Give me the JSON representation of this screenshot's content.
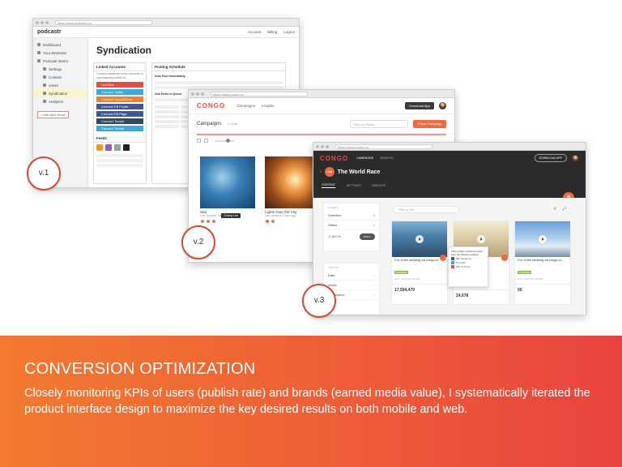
{
  "v1": {
    "url": "https://www.podcastr.co",
    "logo": "podcastr",
    "top_links": [
      "Account",
      "Billing",
      "Logout"
    ],
    "sidebar": [
      "Dashboard",
      "Your Moments",
      "Podcastr Demo",
      "Settings",
      "Content",
      "Users",
      "Syndication",
      "Analytics"
    ],
    "add_button": "+ Add New Show",
    "title": "Syndication",
    "linked_accounts_title": "Linked Accounts",
    "linked_accounts_text": "Connect additional social accounts to automatically publish to.",
    "accounts": [
      {
        "label": "YouTube",
        "color": "#e74c3c"
      },
      {
        "label": "Connect Twitter",
        "color": "#39a9e0"
      },
      {
        "label": "Connect SoundCloud",
        "color": "#f57e20"
      },
      {
        "label": "Connect FB Profile",
        "color": "#3b5998"
      },
      {
        "label": "Connect FB Page",
        "color": "#3b5998"
      },
      {
        "label": "Connect Tumblr",
        "color": "#34495e"
      },
      {
        "label": "Connect Tumblr",
        "color": "#39a9e0"
      }
    ],
    "feeds_title": "Feeds",
    "posting_title": "Posting Schedule",
    "auto_post": "Auto Post Immediately",
    "add_posts": "Add Posts to Queue"
  },
  "v2": {
    "url": "https://www.congo.co",
    "logo": "CONGO",
    "links": [
      "Campaigns",
      "Insights"
    ],
    "download_button": "Download App",
    "campaigns_label": "Campaigns",
    "total": "4 Total",
    "search_placeholder": "Filter by Name",
    "new_campaign": "+ New Campaign",
    "cards": [
      {
        "title": "Sea",
        "sub": "Last updated 2 days ago"
      },
      {
        "title": "Lights Over the City",
        "sub": "Last updated 4 days ago"
      }
    ],
    "tooltip": "Tommy Lee"
  },
  "v3": {
    "url": "https://www.congo.co",
    "logo": "CONGO",
    "nav": [
      "CAMPAIGNS",
      "INSIGHTS"
    ],
    "download_button": "DOWNLOAD APP",
    "campaign_badge": "TWR",
    "campaign_title": "The World Race",
    "tabs": [
      "CONTENT",
      "SETTINGS",
      "INSIGHTS"
    ],
    "fab": "+",
    "filter_label": "FILTERS",
    "filters": [
      "Selection",
      "Status"
    ],
    "filter_count": "11,689 Re",
    "apply": "APPLY",
    "sort_label": "SORT BY",
    "sorts": [
      "Date",
      "Views",
      "Description"
    ],
    "search_placeholder": "Filter by Title",
    "cards": [
      {
        "title": "Fun of the wedding via congo.co",
        "tag": "Published",
        "date": "Apr 3, 2016 at 9:02 AM",
        "stat": "17,594,470"
      },
      {
        "title": "",
        "tag": "",
        "date": "",
        "stat": "24,678"
      },
      {
        "title": "Fun of the wedding via congo.co",
        "tag": "Published",
        "date": "Apr 3, 2016 at 9:02 AM",
        "stat": "00"
      }
    ],
    "popover": {
      "text": "This number combines views from the following outlets:",
      "rows": [
        "300 Facebook",
        "75 twitter",
        "996 YouTube"
      ]
    }
  },
  "badges": [
    "v.1",
    "v.2",
    "v.3"
  ],
  "footer": {
    "heading": "CONVERSION OPTIMIZATION",
    "body": "Closely monitoring KPIs of users (publish rate) and brands (earned media value), I systematically iterated the product interface design to maximize the key desired results on both mobile and web."
  }
}
